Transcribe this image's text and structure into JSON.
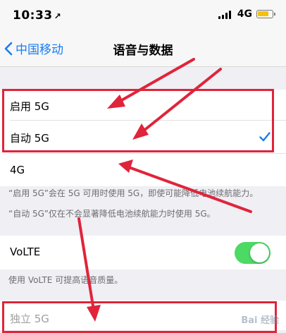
{
  "status_bar": {
    "time": "10:33",
    "location_glyph": "↗",
    "network": "4G"
  },
  "nav": {
    "back_label": "中国移动",
    "title": "语音与数据"
  },
  "mode_options": [
    {
      "label": "启用 5G",
      "selected": false
    },
    {
      "label": "自动 5G",
      "selected": true
    },
    {
      "label": "4G",
      "selected": false
    }
  ],
  "notes": [
    "“启用 5G”会在 5G 可用时使用 5G，即使可能降低电池续航能力。",
    "“自动 5G”仅在不会显著降低电池续航能力时使用 5G。"
  ],
  "volte": {
    "label": "VoLTE",
    "on": true,
    "note": "使用 VoLTE 可提高语音质量。"
  },
  "standalone": {
    "label": "独立 5G"
  },
  "watermark": "Bai 经验",
  "colors": {
    "accent": "#1a7cf2",
    "toggle_on": "#4cd964",
    "annotation": "#e0243a"
  }
}
